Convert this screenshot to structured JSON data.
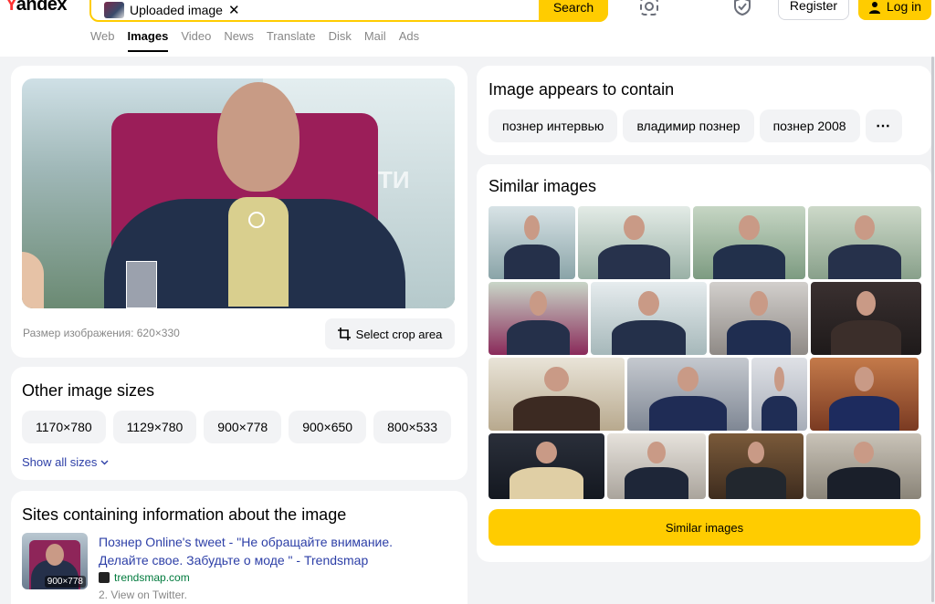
{
  "header": {
    "logo": "Yandex",
    "search_chip": "Uploaded image",
    "search_button": "Search",
    "register": "Register",
    "login": "Log in",
    "icons": [
      "camera-icon",
      "shield-icon"
    ]
  },
  "nav": [
    "Web",
    "Images",
    "Video",
    "News",
    "Translate",
    "Disk",
    "Mail",
    "Ads"
  ],
  "nav_active": "Images",
  "preview": {
    "watermark": "ТИ",
    "size_label": "Размер изображения: 620×330",
    "crop_button": "Select crop area"
  },
  "other_sizes": {
    "title": "Other image sizes",
    "sizes": [
      "1170×780",
      "1129×780",
      "900×778",
      "900×650",
      "800×533"
    ],
    "show_all": "Show all sizes"
  },
  "sites": {
    "title": "Sites containing information about the image",
    "items": [
      {
        "thumb_size": "900×778",
        "title": "Познер Online's tweet - \"Не обращайте внимание. Делайте свое. Забудьте о моде \" - Trendsmap",
        "domain": "trendsmap.com",
        "snippet": "2. View on Twitter."
      }
    ]
  },
  "contains": {
    "title": "Image appears to contain",
    "tags": [
      "познер интервью",
      "владимир познер",
      "познер 2008"
    ]
  },
  "similar": {
    "title": "Similar images",
    "button": "Similar images"
  },
  "colors": {
    "accent": "#ffcc00",
    "link": "#2d3fa7",
    "domain": "#007a3d"
  }
}
